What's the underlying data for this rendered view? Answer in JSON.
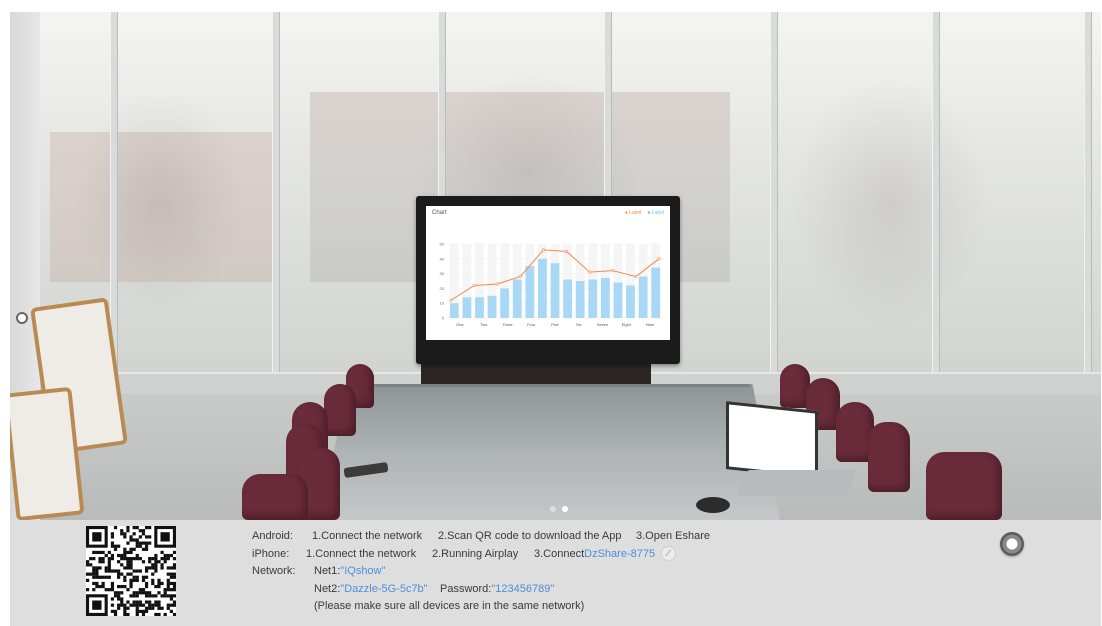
{
  "scene": {
    "tv_chart": {
      "title": "Chart",
      "legend": [
        "Label",
        "Label"
      ],
      "y_ticks": [
        "50",
        "40",
        "30",
        "20",
        "10",
        "0"
      ],
      "categories": [
        "One",
        "Two",
        "Three",
        "Four",
        "Five",
        "Six",
        "Seven",
        "Eight",
        "Nine"
      ],
      "bar_values": [
        10,
        14,
        14,
        15,
        20,
        26,
        35,
        40,
        37,
        26,
        25,
        26,
        27,
        24,
        22,
        28,
        34
      ],
      "line_values": [
        12,
        22,
        23,
        28,
        46,
        45,
        31,
        32,
        28,
        40
      ],
      "colors": {
        "bar": "#a9d8f6",
        "line": "#f08a4b",
        "grid": "#efefef"
      }
    },
    "pager": {
      "count": 2,
      "active": 2
    }
  },
  "panel": {
    "android": {
      "label": "Android:",
      "steps": [
        "1.Connect the network",
        "2.Scan QR code to download the App",
        "3.Open Eshare"
      ]
    },
    "iphone": {
      "label": "iPhone:",
      "steps": [
        "1.Connect the network",
        "2.Running Airplay",
        "3.Connect"
      ],
      "device_name": "DzShare-8775"
    },
    "network": {
      "label": "Network:",
      "net1_label": "Net1:",
      "net1_value": "\"IQshow\"",
      "net2_label": "Net2:",
      "net2_value": "\"Dazzle-5G-5c7b\"",
      "password_label": "Password:",
      "password_value": "\"123456789\"",
      "note": "(Please make sure all devices are in the same network)"
    },
    "icons": {
      "edit": "edit-pencil-icon",
      "home": "ring-home-icon"
    }
  }
}
